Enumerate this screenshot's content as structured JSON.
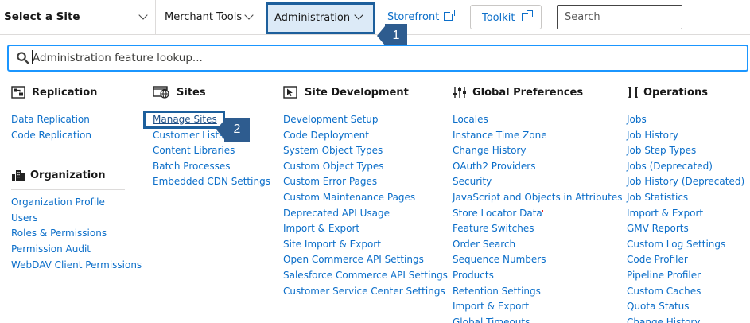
{
  "topbar": {
    "site_select_label": "Select a Site",
    "merchant_tools_label": "Merchant Tools",
    "administration_label": "Administration",
    "storefront_label": "Storefront",
    "toolkit_label": "Toolkit",
    "search_placeholder": "Search"
  },
  "callouts": {
    "one": "1",
    "two": "2"
  },
  "lookup": {
    "placeholder": "Administration feature lookup..."
  },
  "colors": {
    "accent": "#1b96ff",
    "link": "#0b6ec9",
    "callout": "#2e5c8f",
    "highlight": "#dceaf7"
  },
  "columns": {
    "replication": {
      "icon": "replication-icon",
      "title": "Replication",
      "items": [
        "Data Replication",
        "Code Replication"
      ]
    },
    "organization": {
      "icon": "organization-icon",
      "title": "Organization",
      "items": [
        "Organization Profile",
        "Users",
        "Roles & Permissions",
        "Permission Audit",
        "WebDAV Client Permissions"
      ]
    },
    "sites": {
      "icon": "sites-icon",
      "title": "Sites",
      "items": [
        "Manage Sites",
        "Customer Lists",
        "Content Libraries",
        "Batch Processes",
        "Embedded CDN Settings"
      ]
    },
    "site_development": {
      "icon": "cursor-icon",
      "title": "Site Development",
      "items": [
        "Development Setup",
        "Code Deployment",
        "System Object Types",
        "Custom Object Types",
        "Custom Error Pages",
        "Custom Maintenance Pages",
        "Deprecated API Usage",
        "Import & Export",
        "Site Import & Export",
        "Open Commerce API Settings",
        "Salesforce Commerce API Settings",
        "Customer Service Center Settings"
      ]
    },
    "global_preferences": {
      "icon": "preferences-icon",
      "title": "Global Preferences",
      "items": [
        "Locales",
        "Instance Time Zone",
        "Change History",
        "OAuth2 Providers",
        "Security",
        "JavaScript and Objects in Attributes",
        "Store Locator Data",
        "Feature Switches",
        "Order Search",
        "Sequence Numbers",
        "Products",
        "Retention Settings",
        "Import & Export",
        "Global Timeouts"
      ]
    },
    "operations": {
      "icon": "operations-icon",
      "title": "Operations",
      "items": [
        "Jobs",
        "Job History",
        "Job Step Types",
        "Jobs (Deprecated)",
        "Job History (Deprecated)",
        "Job Statistics",
        "Import & Export",
        "GMV Reports",
        "Custom Log Settings",
        "Code Profiler",
        "Pipeline Profiler",
        "Custom Caches",
        "Quota Status",
        "Change History"
      ]
    }
  }
}
